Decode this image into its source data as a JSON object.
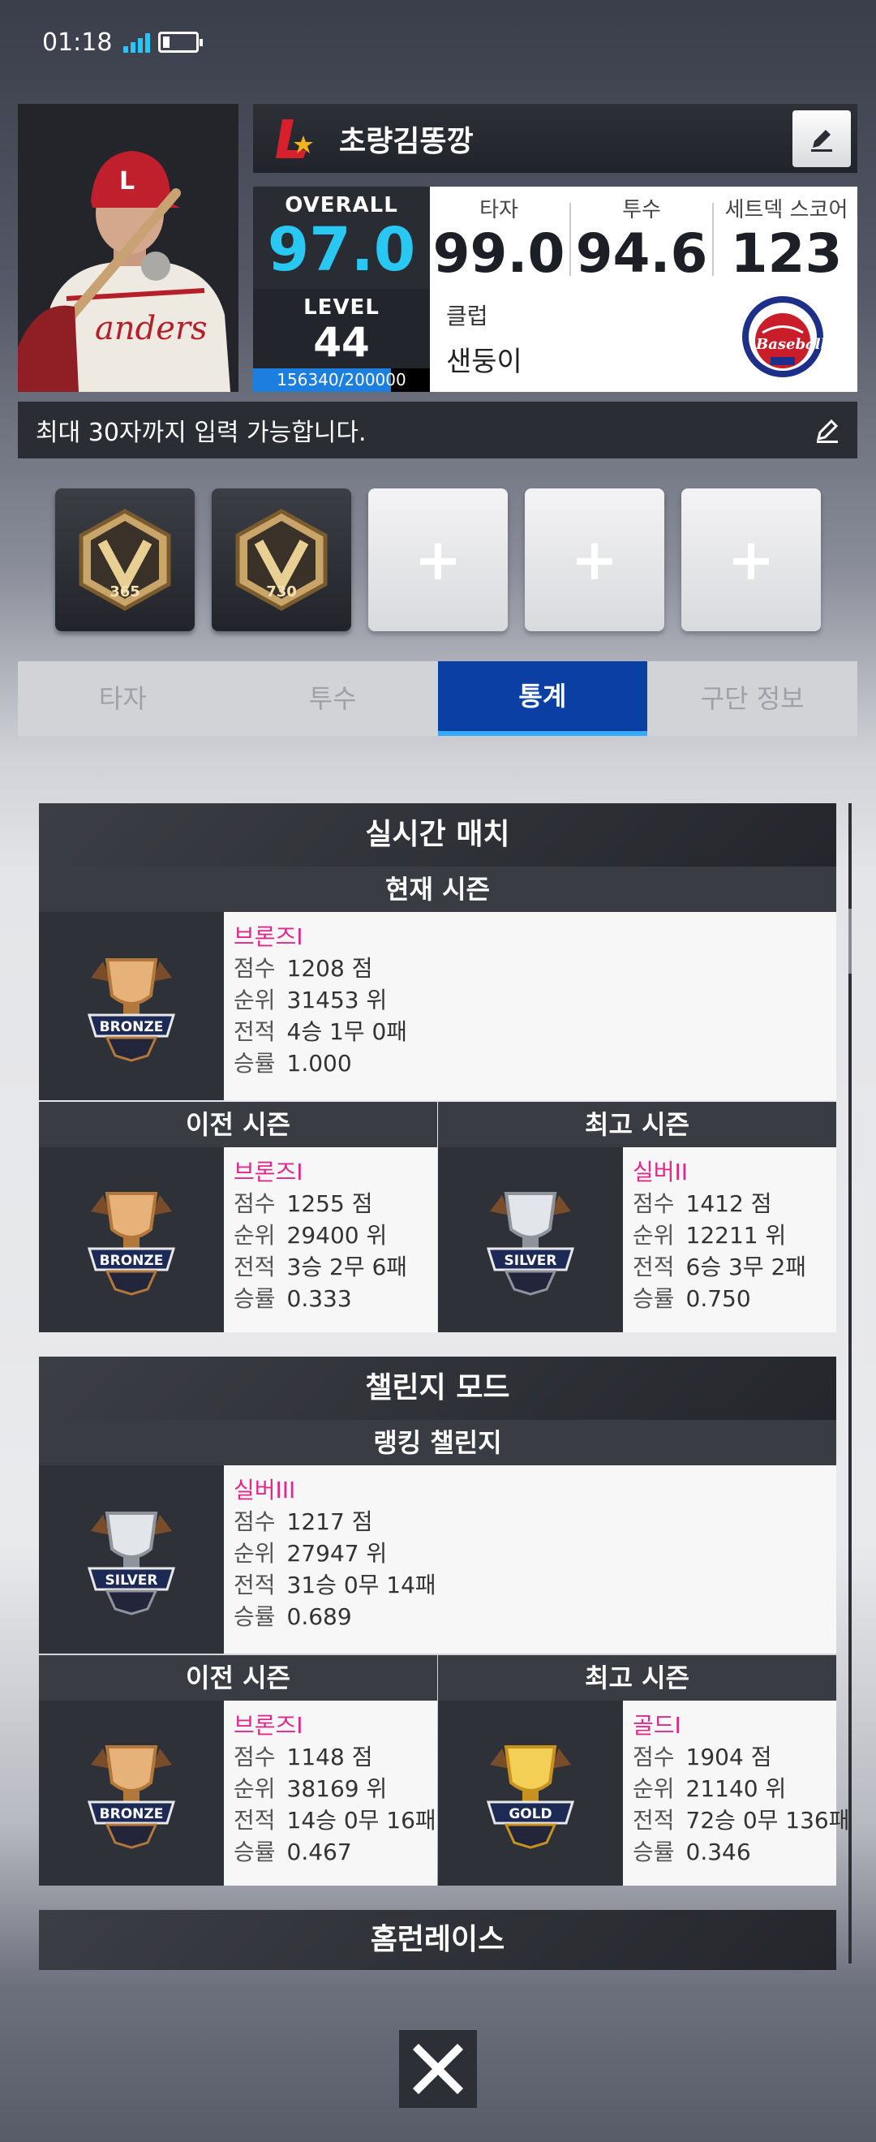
{
  "status": {
    "time": "01:18"
  },
  "profile": {
    "nickname": "초량김똥깡",
    "overall_label": "OVERALL",
    "overall_value": "97.0",
    "level_label": "LEVEL",
    "level_value": "44",
    "xp_text": "156340/200000",
    "xp_fraction": 0.7817,
    "stats": [
      {
        "label": "타자",
        "value": "99.0"
      },
      {
        "label": "투수",
        "value": "94.6"
      },
      {
        "label": "세트덱 스코어",
        "value": "123"
      }
    ],
    "club_label": "클럽",
    "club_name": "샌둥이",
    "bio": "최대 30자까지 입력 가능합니다."
  },
  "badges": [
    {
      "number": "365"
    },
    {
      "number": "730"
    },
    {
      "label": "+"
    },
    {
      "label": "+"
    },
    {
      "label": "+"
    }
  ],
  "tabs": [
    "타자",
    "투수",
    "통계",
    "구단 정보"
  ],
  "active_tab": "통계",
  "realtime": {
    "title": "실시간 매치",
    "current_label": "현재 시즌",
    "prev_label": "이전 시즌",
    "best_label": "최고 시즌",
    "current": {
      "tier": "브론즈I",
      "score": "1208 점",
      "rank": "31453 위",
      "record": "4승 1무 0패",
      "rate": "1.000",
      "emblem": "BRONZE"
    },
    "prev": {
      "tier": "브론즈I",
      "score": "1255 점",
      "rank": "29400 위",
      "record": "3승 2무 6패",
      "rate": "0.333",
      "emblem": "BRONZE"
    },
    "best": {
      "tier": "실버II",
      "score": "1412 점",
      "rank": "12211 위",
      "record": "6승 3무 2패",
      "rate": "0.750",
      "emblem": "SILVER"
    }
  },
  "challenge": {
    "title": "챌린지 모드",
    "ranking_label": "랭킹 챌린지",
    "prev_label": "이전 시즌",
    "best_label": "최고 시즌",
    "current": {
      "tier": "실버III",
      "score": "1217 점",
      "rank": "27947 위",
      "record": "31승 0무 14패",
      "rate": "0.689",
      "emblem": "SILVER"
    },
    "prev": {
      "tier": "브론즈I",
      "score": "1148 점",
      "rank": "38169 위",
      "record": "14승 0무 16패",
      "rate": "0.467",
      "emblem": "BRONZE"
    },
    "best": {
      "tier": "골드I",
      "score": "1904 점",
      "rank": "21140 위",
      "record": "72승 0무 136패",
      "rate": "0.346",
      "emblem": "GOLD"
    }
  },
  "labels": {
    "score": "점수",
    "rank": "순위",
    "record": "전적",
    "rate": "승률"
  },
  "homerun": {
    "title": "홈런레이스"
  },
  "colors": {
    "accent": "#29c8f3",
    "tab_active": "#0b3fa3",
    "tier_text": "#e0288a"
  }
}
